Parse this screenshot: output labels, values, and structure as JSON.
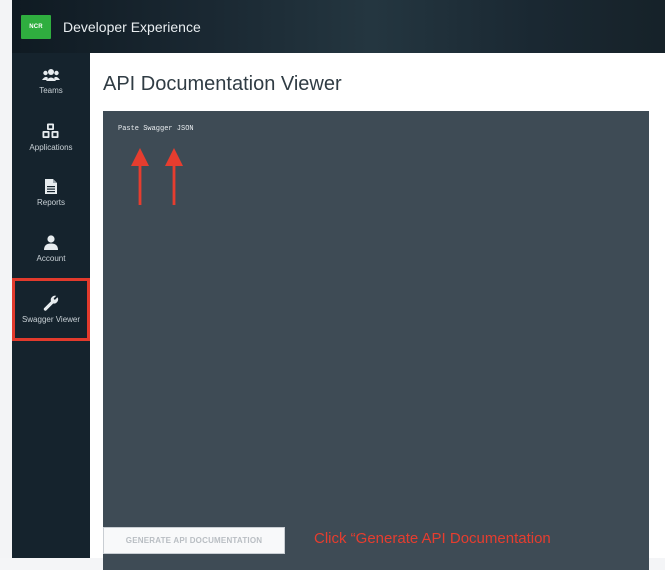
{
  "header": {
    "logo_text": "NCR",
    "app_title": "Developer Experience"
  },
  "sidebar": {
    "items": [
      {
        "label": "Teams",
        "icon": "team-icon"
      },
      {
        "label": "Applications",
        "icon": "cubes-icon"
      },
      {
        "label": "Reports",
        "icon": "document-icon"
      },
      {
        "label": "Account",
        "icon": "user-icon"
      },
      {
        "label": "Swagger Viewer",
        "icon": "wrench-icon",
        "active": true
      }
    ]
  },
  "main": {
    "title": "API Documentation Viewer",
    "editor_placeholder": "Paste Swagger JSON",
    "generate_button": "GENERATE API DOCUMENTATION"
  },
  "annotations": {
    "instruction": "Click “Generate API  Documentation",
    "highlight_color": "#e23a2c"
  },
  "colors": {
    "brand_green": "#2fae3f",
    "sidebar_bg": "#15232d",
    "editor_bg": "#3e4b55"
  }
}
